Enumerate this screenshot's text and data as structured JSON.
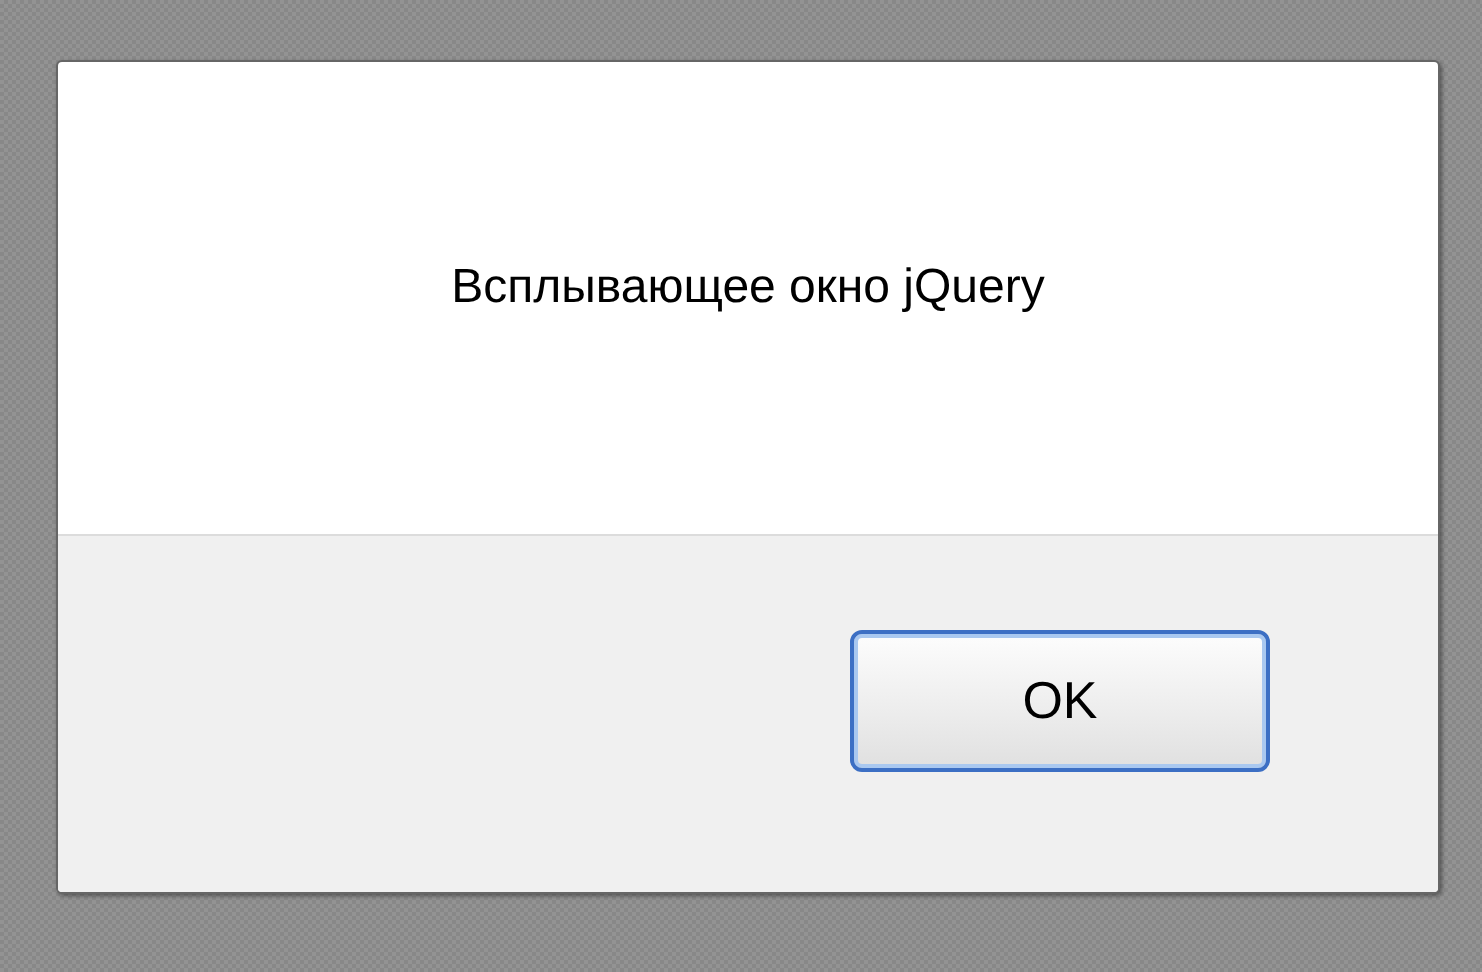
{
  "dialog": {
    "message": "Всплывающее окно jQuery",
    "buttons": [
      "OK"
    ]
  }
}
